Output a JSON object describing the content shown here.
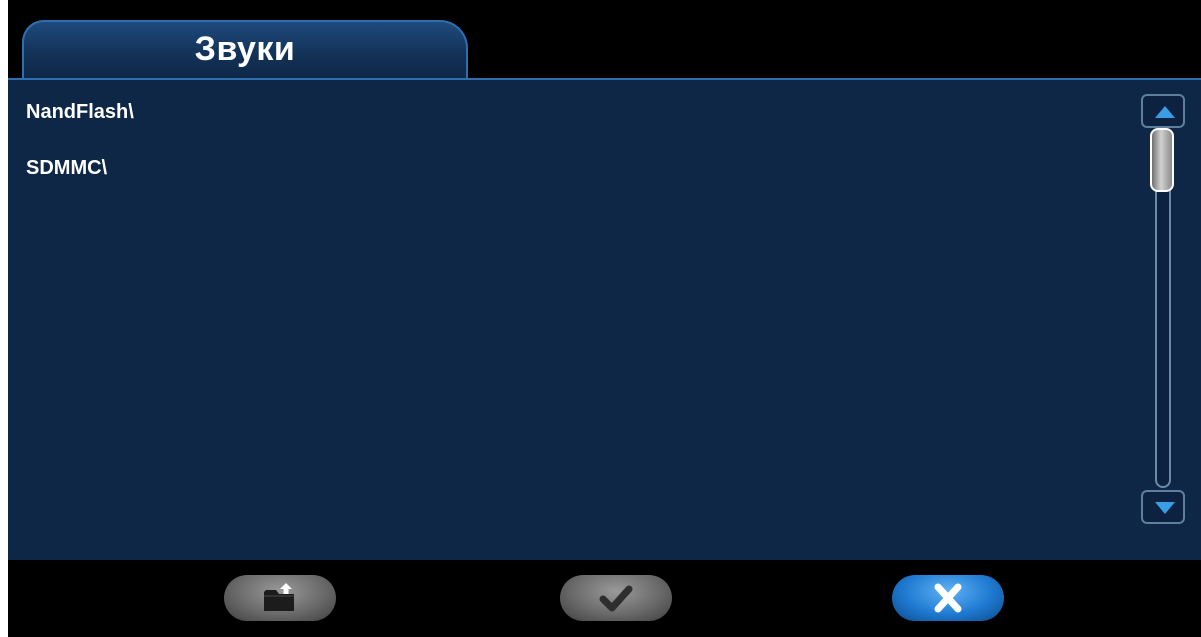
{
  "dialog": {
    "tab_title": "Звуки"
  },
  "file_list": [
    {
      "label": "NandFlash\\"
    },
    {
      "label": "SDMMC\\"
    }
  ],
  "scrollbar": {
    "up_icon": "triangle-up-icon",
    "down_icon": "triangle-down-icon",
    "scroll_position": 0
  },
  "bottom_bar": {
    "buttons": [
      {
        "name": "parent-folder-button",
        "icon": "folder-up-icon",
        "style": "gray"
      },
      {
        "name": "confirm-button",
        "icon": "checkmark-icon",
        "style": "gray"
      },
      {
        "name": "cancel-button",
        "icon": "close-icon",
        "style": "blue"
      }
    ]
  },
  "colors": {
    "panel_bg": "#0f2746",
    "accent_border": "#2e6fb0",
    "button_blue": "#1f7ad1",
    "button_gray": "#6a6a6a",
    "arrow_blue": "#3a9ee6"
  }
}
